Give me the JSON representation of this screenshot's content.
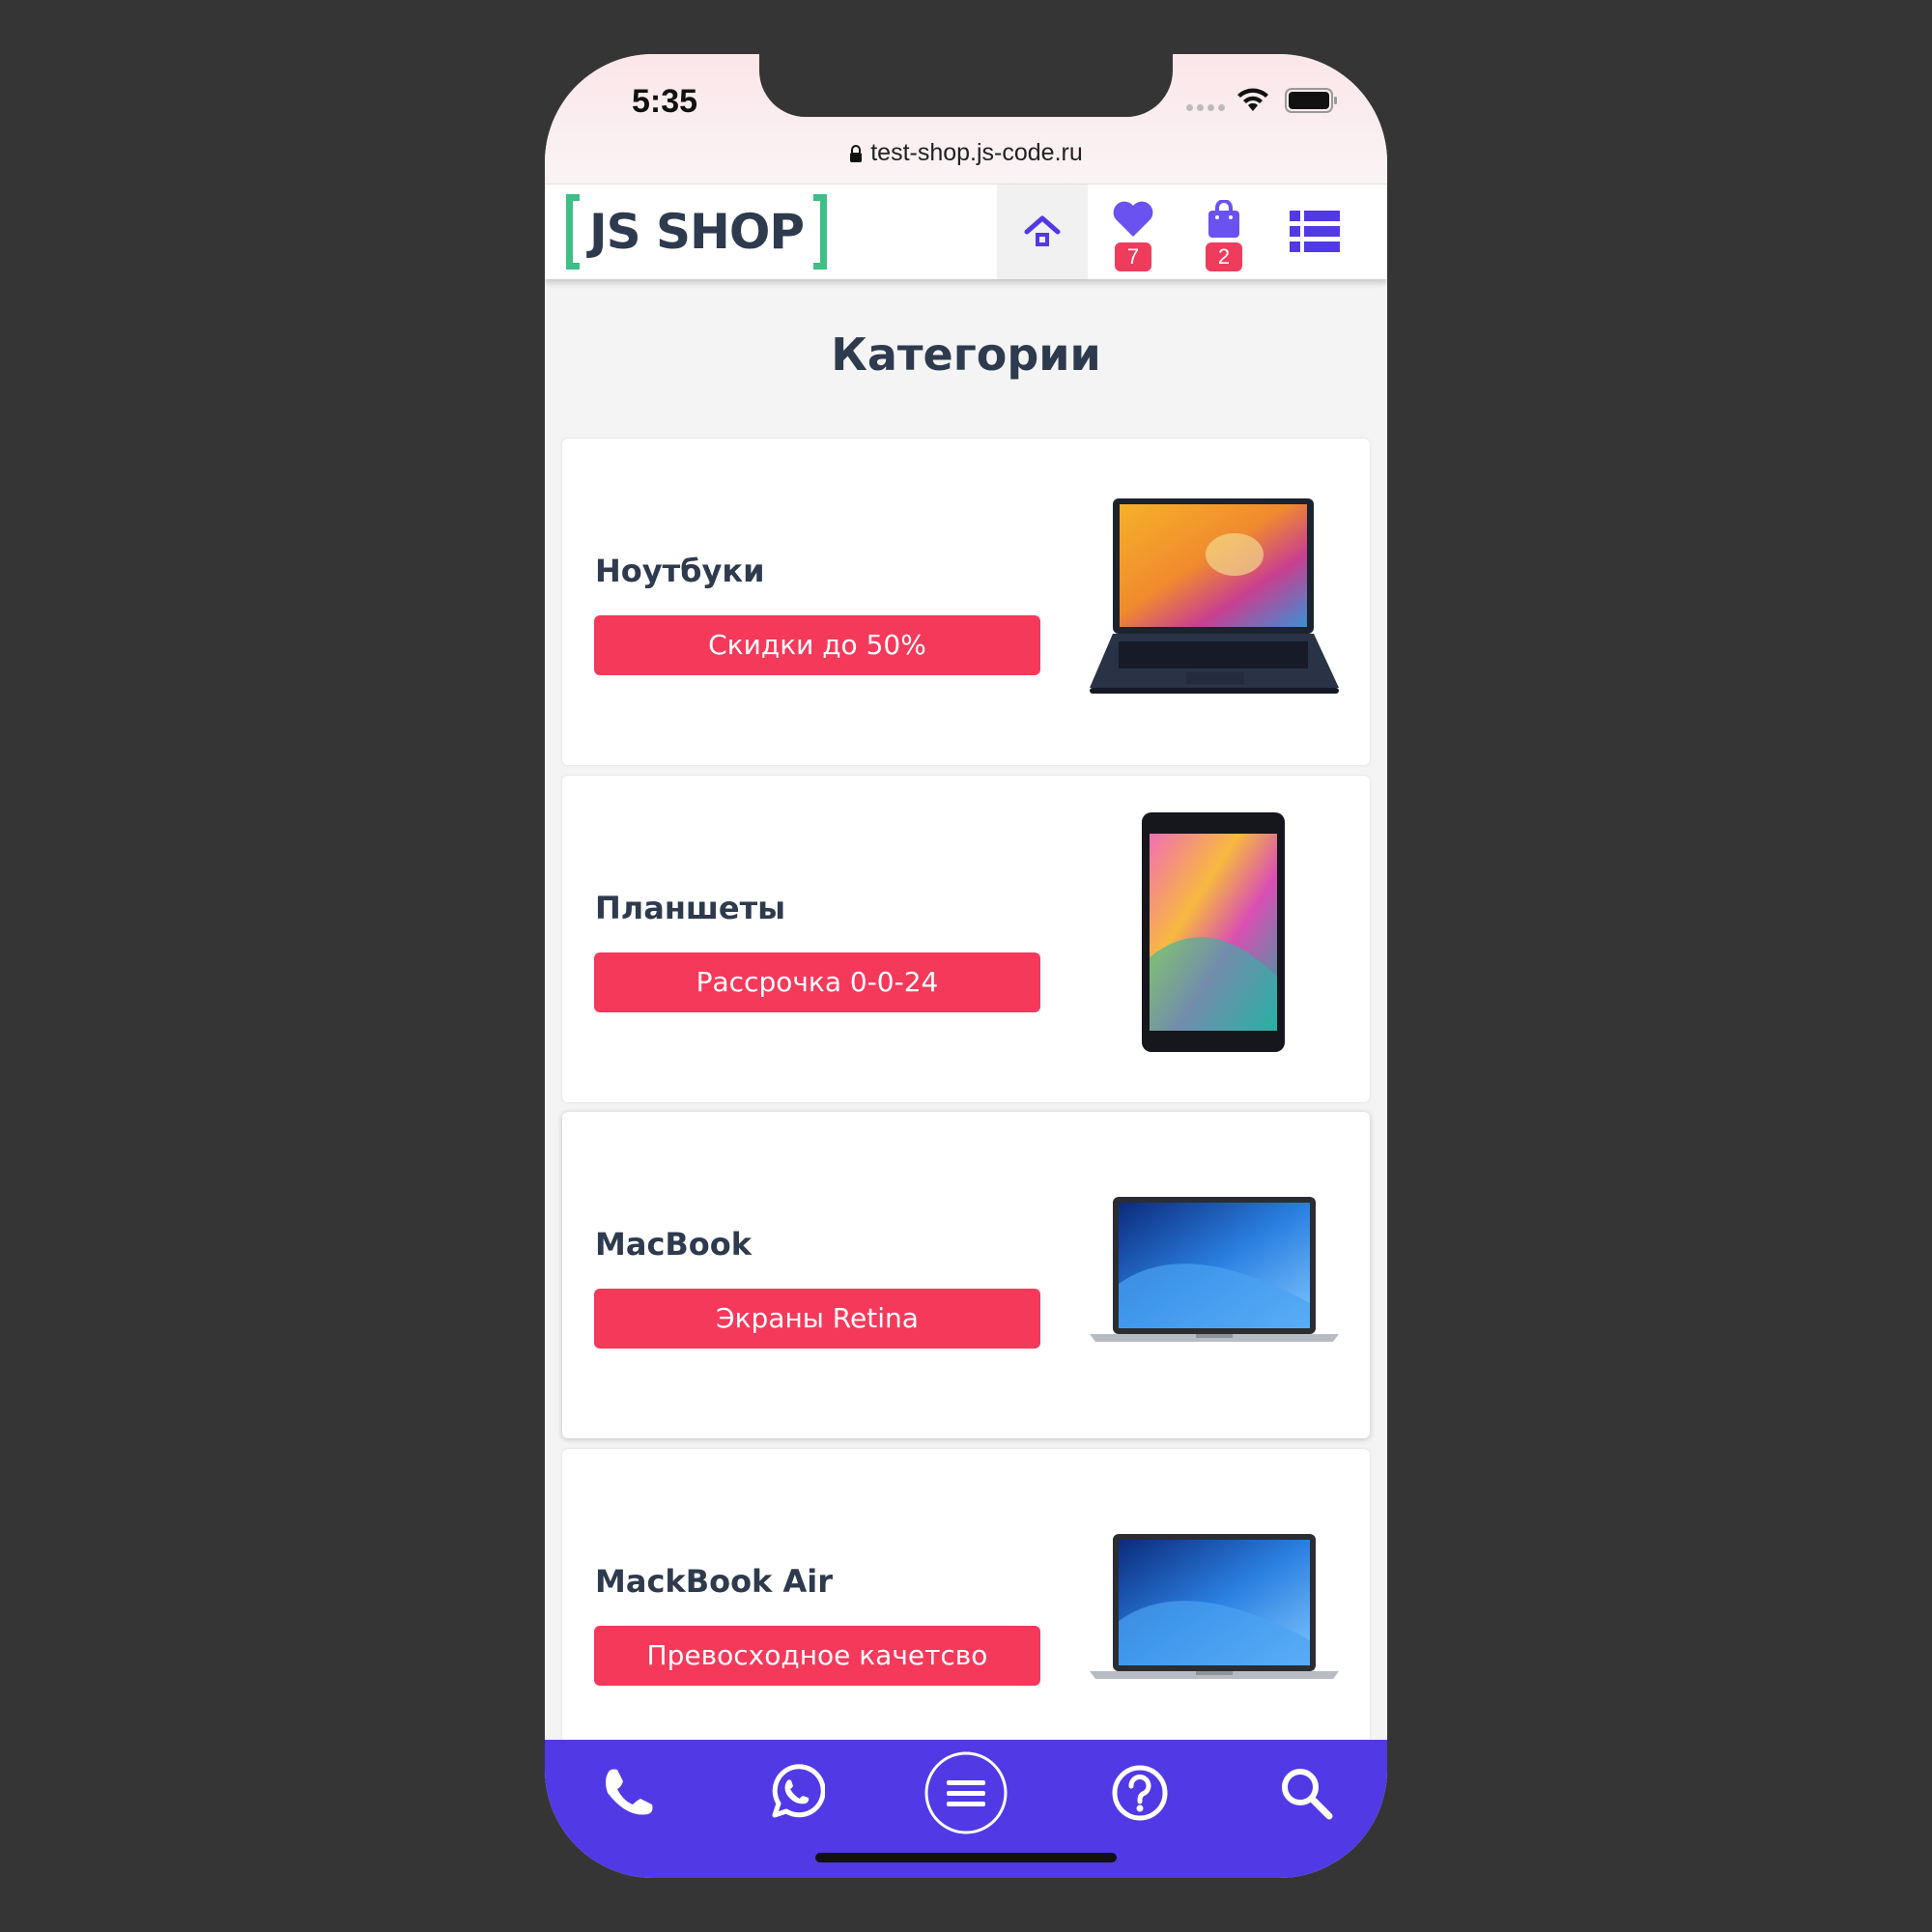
{
  "status_bar": {
    "time": "5:35"
  },
  "browser": {
    "url": "test-shop.js-code.ru"
  },
  "header": {
    "logo_text": "JS SHOP",
    "favorites_count": "7",
    "cart_count": "2"
  },
  "page": {
    "title": "Категории"
  },
  "categories": [
    {
      "name": "Ноутбуки",
      "promo": "Скидки до 50%"
    },
    {
      "name": "Планшеты",
      "promo": "Рассрочка 0-0-24"
    },
    {
      "name": "MacBook",
      "promo": "Экраны Retina"
    },
    {
      "name": "MackBook Air",
      "promo": "Превосходное качетсво"
    }
  ],
  "colors": {
    "accent": "#5139e6",
    "promo": "#f4395b",
    "logo_bracket": "#3dbf85",
    "heading": "#2e3a4d"
  },
  "icons": {
    "header": [
      "home-icon",
      "heart-icon",
      "shopping-bag-icon",
      "list-icon"
    ],
    "bottom_bar": [
      "phone-icon",
      "whatsapp-icon",
      "menu-icon",
      "help-icon",
      "search-icon"
    ]
  }
}
